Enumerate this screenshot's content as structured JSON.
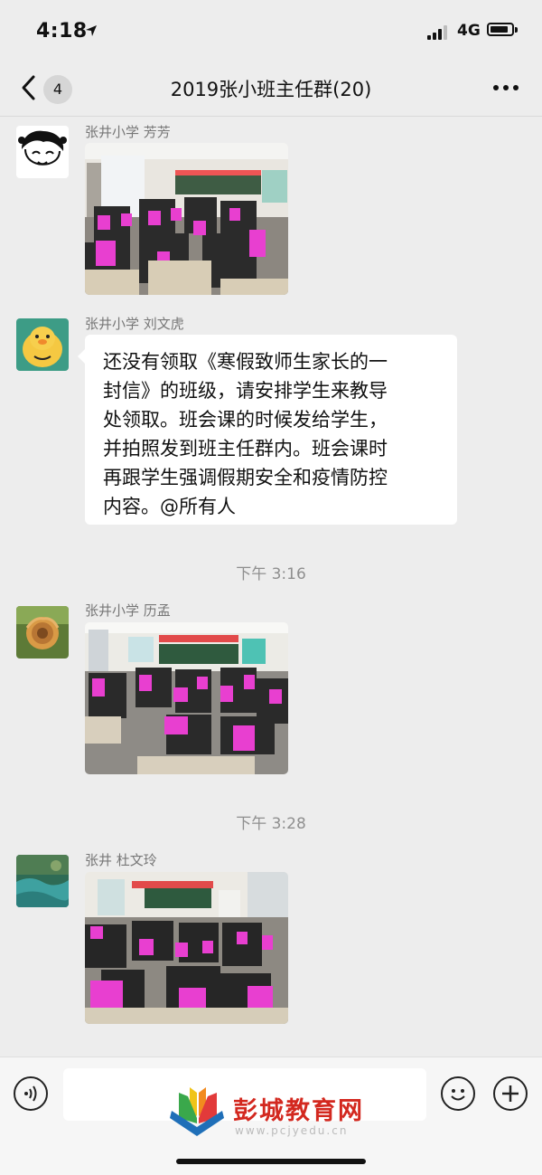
{
  "status_bar": {
    "time": "4:18",
    "network": "4G"
  },
  "header": {
    "back_badge": "4",
    "title": "2019张小班主任群(20)"
  },
  "messages": [
    {
      "sender": "张井小学 芳芳",
      "type": "image",
      "image_desc": "classroom-students-holding-pink-letters"
    },
    {
      "sender": "张井小学 刘文虎",
      "type": "text",
      "lines": [
        "还没有领取《寒假致师生家长的一",
        "封信》的班级，请安排学生来教导",
        "处领取。班会课的时候发给学生，",
        "并拍照发到班主任群内。班会课时",
        "再跟学生强调假期安全和疫情防控",
        "内容。@所有人"
      ]
    },
    {
      "timestamp": "下午 3:16"
    },
    {
      "sender": "张井小学 历孟",
      "type": "image",
      "image_desc": "classroom-students-holding-pink-letters"
    },
    {
      "timestamp": "下午 3:28"
    },
    {
      "sender": "张井 杜文玲",
      "type": "image",
      "image_desc": "classroom-students-holding-pink-letters"
    }
  ],
  "input_bar": {
    "voice_icon": "voice-icon",
    "emoji_icon": "emoji-icon",
    "plus_icon": "plus-icon"
  },
  "watermark": {
    "text": "彭城教育网",
    "url": "www.pcjyedu.cn"
  },
  "colors": {
    "background": "#ededed",
    "bubble": "#ffffff",
    "letter_pink": "#e83fd0",
    "watermark_red": "#d3281f"
  }
}
